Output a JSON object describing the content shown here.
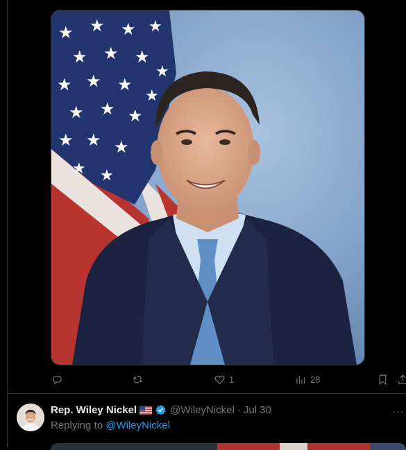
{
  "tweet_actions": {
    "reply_count": "",
    "retweet_count": "",
    "like_count": "1",
    "views_count": "28"
  },
  "reply_tweet": {
    "display_name": "Rep. Wiley Nickel",
    "handle": "@WileyNickel",
    "separator": "·",
    "date": "Jul 30",
    "replying_prefix": "Replying to ",
    "replying_to": "@WileyNickel",
    "more_label": "···"
  },
  "colors": {
    "background": "#000000",
    "border": "#2f3336",
    "muted_text": "#71767b",
    "accent_blue": "#1d9bf0",
    "verified_blue": "#1d9bf0"
  },
  "icons": {
    "reply": "reply-icon",
    "retweet": "retweet-icon",
    "like": "heart-icon",
    "views": "bar-chart-icon",
    "bookmark": "bookmark-icon",
    "share": "share-icon",
    "verified": "verified-badge-icon",
    "flag": "us-flag-emoji"
  }
}
